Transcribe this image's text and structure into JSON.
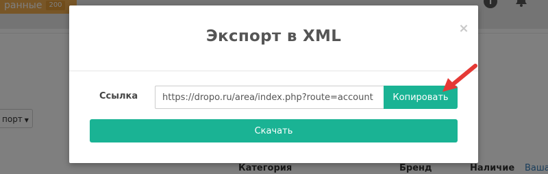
{
  "background": {
    "tab_label": "ранные",
    "tab_badge": "200",
    "export_button": "порт",
    "table_headers": {
      "category": "Категория",
      "brand": "Бренд",
      "availability": "Наличие"
    },
    "link_partial": "Ваша"
  },
  "modal": {
    "title": "Экспорт в XML",
    "close_symbol": "×",
    "link_label": "Ссылка",
    "link_value": "https://dropo.ru/area/index.php?route=account",
    "copy_button": "Копировать",
    "download_button": "Скачать"
  },
  "colors": {
    "primary": "#1ab394",
    "arrow": "#e53935",
    "tab": "#f0ad4e"
  },
  "icons": {
    "info": "info-icon",
    "bell": "bell-icon",
    "annotation": "red-arrow-icon"
  }
}
